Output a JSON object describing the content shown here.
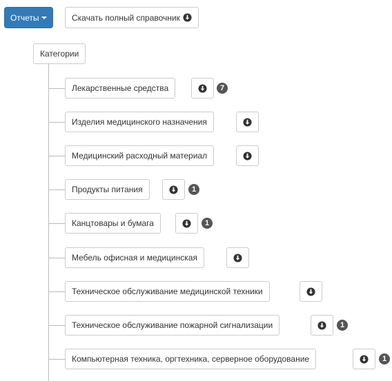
{
  "toolbar": {
    "reports_label": "Отчеты",
    "download_full_label": "Скачать полный справочник"
  },
  "tree": {
    "root_label": "Категории",
    "items": [
      {
        "label": "Лекарственные средства",
        "badge": "7"
      },
      {
        "label": "Изделия медицинского назначения",
        "badge": ""
      },
      {
        "label": "Медицинский расходный материал",
        "badge": ""
      },
      {
        "label": "Продукты питания",
        "badge": "1"
      },
      {
        "label": "Канцтовары и бумага",
        "badge": "1"
      },
      {
        "label": "Мебель офисная и медицинская",
        "badge": ""
      },
      {
        "label": "Техническое обслуживание медицинской техники",
        "badge": ""
      },
      {
        "label": "Техническое обслуживание пожарной сигнализации",
        "badge": "1"
      },
      {
        "label": "Компьютерная техника, оргтехника, серверное оборудование",
        "badge": "1"
      }
    ]
  },
  "icons": {
    "download": "download-circle-icon",
    "dropdown": "caret-down-icon"
  },
  "colors": {
    "primary": "#337ab7",
    "badge": "#555555",
    "tree_line": "#bbbbbb"
  }
}
